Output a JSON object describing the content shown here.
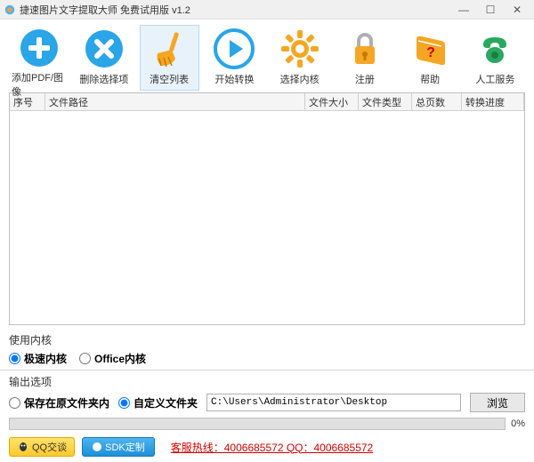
{
  "window": {
    "title": "捷速图片文字提取大师 免费试用版 v1.2"
  },
  "toolbar": [
    {
      "id": "add",
      "label": "添加PDF/图像"
    },
    {
      "id": "delete",
      "label": "删除选择项"
    },
    {
      "id": "clear",
      "label": "清空列表"
    },
    {
      "id": "start",
      "label": "开始转换"
    },
    {
      "id": "kernel",
      "label": "选择内核"
    },
    {
      "id": "register",
      "label": "注册"
    },
    {
      "id": "help",
      "label": "帮助"
    },
    {
      "id": "service",
      "label": "人工服务"
    }
  ],
  "active_tool": "clear",
  "table": {
    "headers": {
      "sn": "序号",
      "path": "文件路径",
      "size": "文件大小",
      "type": "文件类型",
      "pages": "总页数",
      "prog": "转换进度"
    }
  },
  "kernel": {
    "label": "使用内核",
    "fast": "极速内核",
    "office": "Office内核",
    "selected": "fast"
  },
  "output": {
    "label": "输出选项",
    "save_orig": "保存在原文件夹内",
    "custom": "自定义文件夹",
    "selected": "custom",
    "path": "C:\\Users\\Administrator\\Desktop",
    "browse": "浏览"
  },
  "progress": {
    "pct": "0%"
  },
  "footer": {
    "qq": "QQ交谈",
    "sdk": "SDK定制",
    "hotline": "客服热线：4006685572 QQ：4006685572"
  }
}
